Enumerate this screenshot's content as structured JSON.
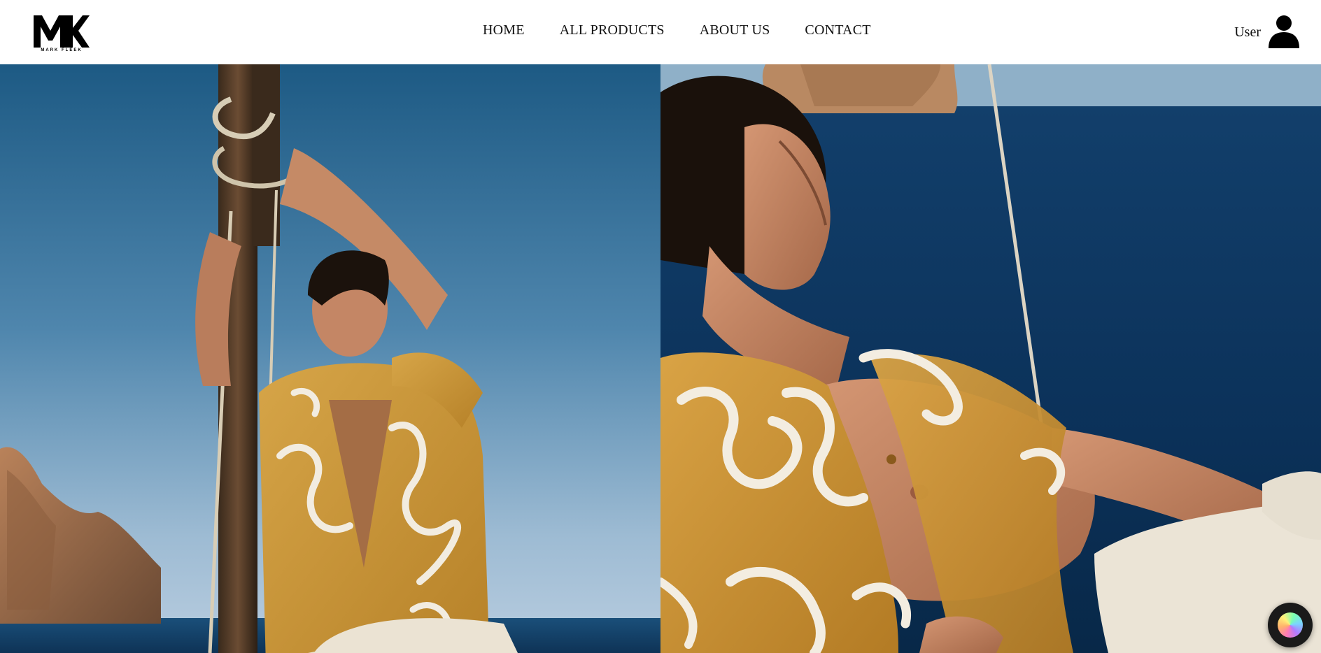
{
  "brand": {
    "logo_text": "MK",
    "logo_subtitle": "MARK FLEEK"
  },
  "nav": {
    "items": [
      {
        "label": "HOME"
      },
      {
        "label": "ALL PRODUCTS"
      },
      {
        "label": "ABOUT US"
      },
      {
        "label": "CONTACT"
      }
    ]
  },
  "user": {
    "label": "User",
    "icon": "user-icon"
  },
  "hero": {
    "images": [
      {
        "icon": "photo-model-mast"
      },
      {
        "icon": "photo-model-reclining"
      }
    ]
  },
  "assistant_button": {
    "icon": "assistant-orb-icon"
  },
  "colors": {
    "header_bg": "#ffffff",
    "text": "#111111",
    "shirt": "#cf9a3a",
    "sea": "#0e3f6e",
    "sky": "#2f6d96"
  }
}
